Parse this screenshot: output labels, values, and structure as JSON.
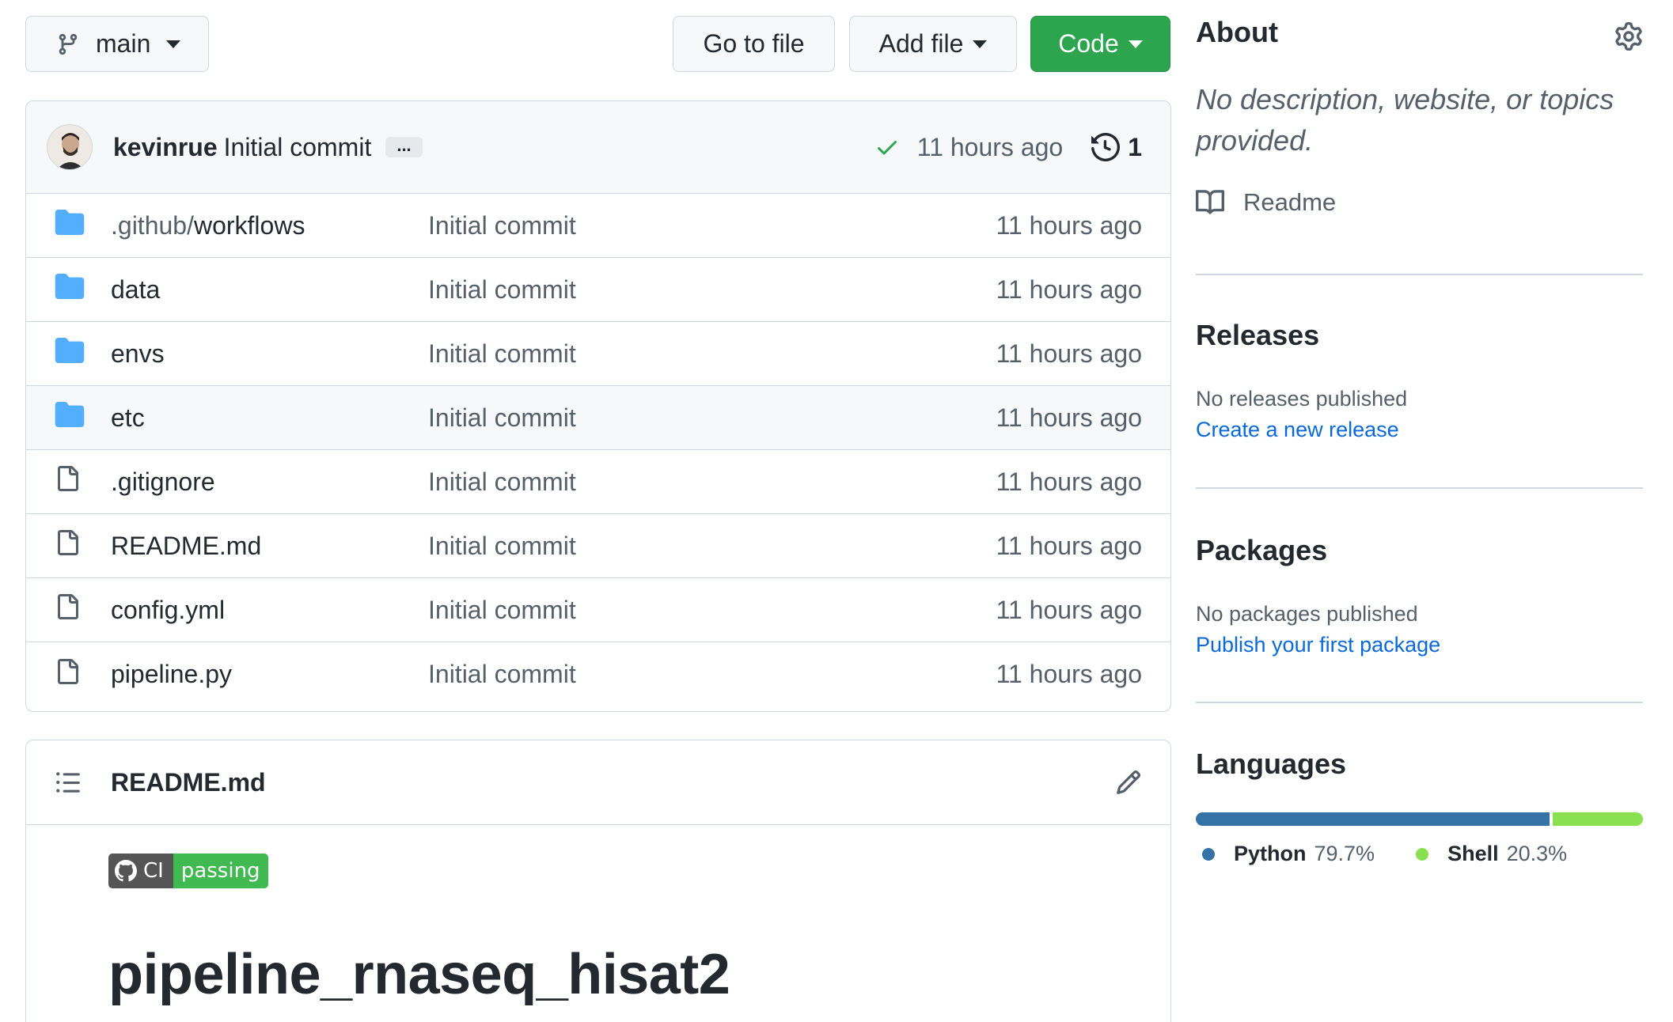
{
  "branch": {
    "label": "main"
  },
  "toolbar": {
    "go_to_file": "Go to file",
    "add_file": "Add file",
    "code": "Code"
  },
  "commit": {
    "author": "kevinrue",
    "message": "Initial commit",
    "ellipsis": "...",
    "time": "11 hours ago",
    "count": "1",
    "status_color": "#2da44e"
  },
  "files": [
    {
      "type": "folder",
      "name_dim": ".github/",
      "name": "workflows",
      "message": "Initial commit",
      "age": "11 hours ago"
    },
    {
      "type": "folder",
      "name_dim": "",
      "name": "data",
      "message": "Initial commit",
      "age": "11 hours ago"
    },
    {
      "type": "folder",
      "name_dim": "",
      "name": "envs",
      "message": "Initial commit",
      "age": "11 hours ago"
    },
    {
      "type": "folder",
      "name_dim": "",
      "name": "etc",
      "message": "Initial commit",
      "age": "11 hours ago"
    },
    {
      "type": "file",
      "name_dim": "",
      "name": ".gitignore",
      "message": "Initial commit",
      "age": "11 hours ago"
    },
    {
      "type": "file",
      "name_dim": "",
      "name": "README.md",
      "message": "Initial commit",
      "age": "11 hours ago"
    },
    {
      "type": "file",
      "name_dim": "",
      "name": "config.yml",
      "message": "Initial commit",
      "age": "11 hours ago"
    },
    {
      "type": "file",
      "name_dim": "",
      "name": "pipeline.py",
      "message": "Initial commit",
      "age": "11 hours ago"
    }
  ],
  "readme": {
    "title": "README.md",
    "badge_left": "CI",
    "badge_right": "passing",
    "heading": "pipeline_rnaseq_hisat2"
  },
  "about": {
    "title": "About",
    "description_line1": "No description, website, or topics",
    "description_line2": "provided.",
    "readme_link": "Readme"
  },
  "releases": {
    "title": "Releases",
    "status": "No releases published",
    "link": "Create a new release"
  },
  "packages": {
    "title": "Packages",
    "status": "No packages published",
    "link": "Publish your first package"
  },
  "languages": {
    "title": "Languages",
    "items": [
      {
        "name": "Python",
        "percent": "79.7%",
        "value": 79.7,
        "color": "#3572A5"
      },
      {
        "name": "Shell",
        "percent": "20.3%",
        "value": 20.3,
        "color": "#89e051"
      }
    ]
  },
  "colors": {
    "accent": "#2da44e",
    "link": "#0969da",
    "folder": "#54aeff"
  }
}
